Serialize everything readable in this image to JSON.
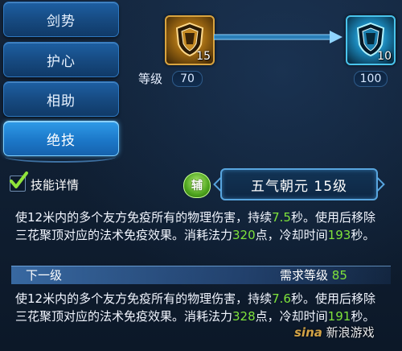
{
  "tabs": [
    {
      "label": "剑势",
      "active": false
    },
    {
      "label": "护心",
      "active": false
    },
    {
      "label": "相助",
      "active": false
    },
    {
      "label": "绝技",
      "active": true
    }
  ],
  "upgrade": {
    "current_icon": "gold-shield-icon",
    "current_level_badge": "15",
    "next_icon": "blue-shield-icon",
    "next_level_badge": "10",
    "level_label": "等级",
    "current_required_level": "70",
    "next_required_level": "100"
  },
  "details": {
    "checkbox_label": "技能详情",
    "checked": true,
    "type_badge": "辅",
    "skill_title": "五气朝元 15级"
  },
  "current_desc": {
    "p1": "使12米内的多个友方免疫所有的物理伤害，持续",
    "duration": "7.5",
    "p2": "秒。使用后移除三花聚顶对应的法术免疫效果。消耗法力",
    "mana": "320",
    "p3": "点，冷却时间",
    "cooldown": "193",
    "p4": "秒。"
  },
  "next_level": {
    "label": "下一级",
    "req_label": "需求等级 ",
    "req_value": "85"
  },
  "next_desc": {
    "p1": "使12米内的多个友方免疫所有的物理伤害，持续",
    "duration": "7.6",
    "p2": "秒。使用后移除三花聚顶对应的法术免疫效果。消耗法力",
    "mana": "328",
    "p3": "点，冷却时间",
    "cooldown": "191",
    "p4": "秒。"
  },
  "watermark": {
    "logo": "sina",
    "text": "新浪游戏"
  },
  "colors": {
    "highlight": "#7ee23b",
    "tab_active": "#2f9be8",
    "tab": "#1d5fa3"
  }
}
